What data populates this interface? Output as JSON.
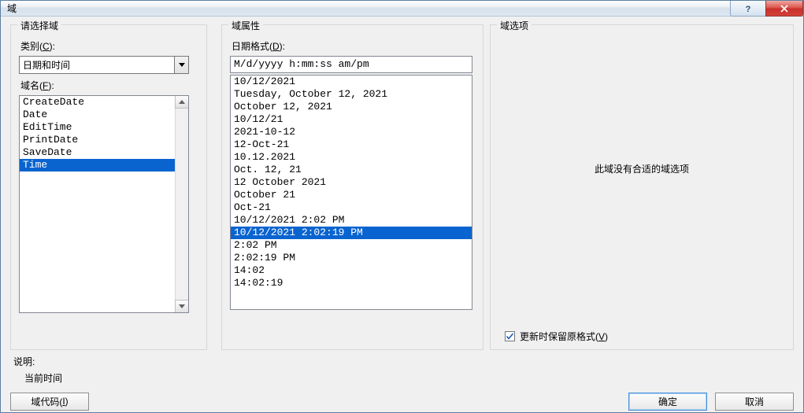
{
  "title": "域",
  "left": {
    "legend": "请选择域",
    "category_label_pre": "类别(",
    "category_label_key": "C",
    "category_label_post": "):",
    "category_value": "日期和时间",
    "fieldname_label_pre": "域名(",
    "fieldname_label_key": "F",
    "fieldname_label_post": "):",
    "items": [
      {
        "text": "CreateDate",
        "selected": false
      },
      {
        "text": "Date",
        "selected": false
      },
      {
        "text": "EditTime",
        "selected": false
      },
      {
        "text": "PrintDate",
        "selected": false
      },
      {
        "text": "SaveDate",
        "selected": false
      },
      {
        "text": "Time",
        "selected": true
      }
    ]
  },
  "mid": {
    "legend": "域属性",
    "format_label_pre": "日期格式(",
    "format_label_key": "D",
    "format_label_post": "):",
    "format_value": "M/d/yyyy h:mm:ss am/pm",
    "formats": [
      {
        "text": "10/12/2021",
        "selected": false
      },
      {
        "text": "Tuesday, October 12, 2021",
        "selected": false
      },
      {
        "text": "October 12, 2021",
        "selected": false
      },
      {
        "text": "10/12/21",
        "selected": false
      },
      {
        "text": "2021-10-12",
        "selected": false
      },
      {
        "text": "12-Oct-21",
        "selected": false
      },
      {
        "text": "10.12.2021",
        "selected": false
      },
      {
        "text": "Oct. 12, 21",
        "selected": false
      },
      {
        "text": "12 October 2021",
        "selected": false
      },
      {
        "text": "October 21",
        "selected": false
      },
      {
        "text": "Oct-21",
        "selected": false
      },
      {
        "text": "10/12/2021 2:02 PM",
        "selected": false
      },
      {
        "text": "10/12/2021 2:02:19 PM",
        "selected": true
      },
      {
        "text": "2:02 PM",
        "selected": false
      },
      {
        "text": "2:02:19 PM",
        "selected": false
      },
      {
        "text": "14:02",
        "selected": false
      },
      {
        "text": "14:02:19",
        "selected": false
      }
    ]
  },
  "right": {
    "legend": "域选项",
    "message": "此域没有合适的域选项",
    "checkbox_label_pre": "更新时保留原格式(",
    "checkbox_label_key": "V",
    "checkbox_label_post": ")",
    "checkbox_checked": true
  },
  "desc": {
    "title": "说明:",
    "value": "当前时间"
  },
  "buttons": {
    "fieldcodes_pre": "域代码(",
    "fieldcodes_key": "I",
    "fieldcodes_post": ")",
    "ok": "确定",
    "cancel": "取消"
  }
}
